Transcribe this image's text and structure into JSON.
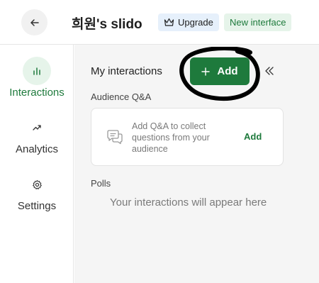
{
  "header": {
    "title": "희원's slido",
    "upgrade_label": "Upgrade",
    "new_interface_label": "New interface"
  },
  "sidebar": {
    "items": [
      {
        "label": "Interactions",
        "icon": "bar-chart-icon",
        "active": true
      },
      {
        "label": "Analytics",
        "icon": "trend-up-icon",
        "active": false
      },
      {
        "label": "Settings",
        "icon": "gear-icon",
        "active": false
      }
    ]
  },
  "main": {
    "title": "My interactions",
    "add_label": "Add",
    "audience_qa": {
      "heading": "Audience Q&A",
      "description": "Add Q&A to collect questions from your audience",
      "add_link": "Add"
    },
    "polls": {
      "heading": "Polls",
      "empty_text": "Your interactions will appear here"
    }
  },
  "colors": {
    "accent": "#1e7a3c",
    "accent_light": "#e6f4ea",
    "upgrade_bg": "#e6f0fb",
    "main_bg": "#f5f5f5"
  }
}
